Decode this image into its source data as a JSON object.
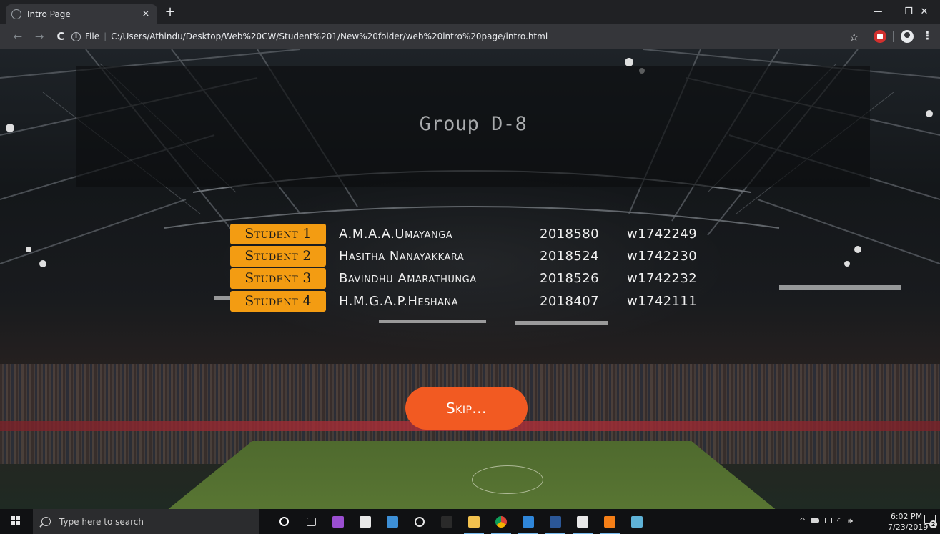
{
  "browser": {
    "tab_title": "Intro Page",
    "tab_close": "×",
    "new_tab": "+",
    "scheme_label": "File",
    "separator": "|",
    "url": "C:/Users/Athindu/Desktop/Web%20CW/Student%201/New%20folder/web%20intro%20page/intro.html",
    "window": {
      "minimize": "—",
      "maximize": "❐",
      "close": "✕"
    },
    "nav": {
      "back": "←",
      "forward": "→",
      "reload": "C"
    },
    "star": "☆",
    "menu": "⋮"
  },
  "page": {
    "title": "Group D-8",
    "students": [
      {
        "label": "Student 1",
        "name": "A.M.A.A.Umayanga",
        "sid": "2018580",
        "wid": "w1742249"
      },
      {
        "label": "Student 2",
        "name": "Hasitha Nanayakkara",
        "sid": "2018524",
        "wid": "w1742230"
      },
      {
        "label": "Student 3",
        "name": "Bavindhu Amarathunga",
        "sid": "2018526",
        "wid": "w1742232"
      },
      {
        "label": "Student 4",
        "name": "H.M.G.A.P.Heshana",
        "sid": "2018407",
        "wid": "w1742111"
      }
    ],
    "skip_label": "Skip..."
  },
  "taskbar": {
    "search_placeholder": "Type here to search",
    "time": "6:02 PM",
    "date": "7/23/2019",
    "notification_count": "2",
    "apps": [
      {
        "name": "cortana-icon",
        "color": "#ffffff"
      },
      {
        "name": "task-view-icon",
        "color": "#d0d0d0"
      },
      {
        "name": "visual-studio-icon",
        "color": "#9b4fd1"
      },
      {
        "name": "mail-icon",
        "color": "#e8e8e8"
      },
      {
        "name": "photos-icon",
        "color": "#3d8fd6"
      },
      {
        "name": "groove-icon",
        "color": "#e8e8e8"
      },
      {
        "name": "terminal-icon",
        "color": "#2a2a2a"
      },
      {
        "name": "file-explorer-icon",
        "color": "#f2c14e"
      },
      {
        "name": "chrome-icon",
        "color": "#d7a93a"
      },
      {
        "name": "edge-icon",
        "color": "#2f86d9"
      },
      {
        "name": "word-icon",
        "color": "#2b5797"
      },
      {
        "name": "dolby-icon",
        "color": "#e8e8e8"
      },
      {
        "name": "sublime-text-icon",
        "color": "#f57f17"
      },
      {
        "name": "notepad-icon",
        "color": "#5fb3d8"
      }
    ]
  }
}
